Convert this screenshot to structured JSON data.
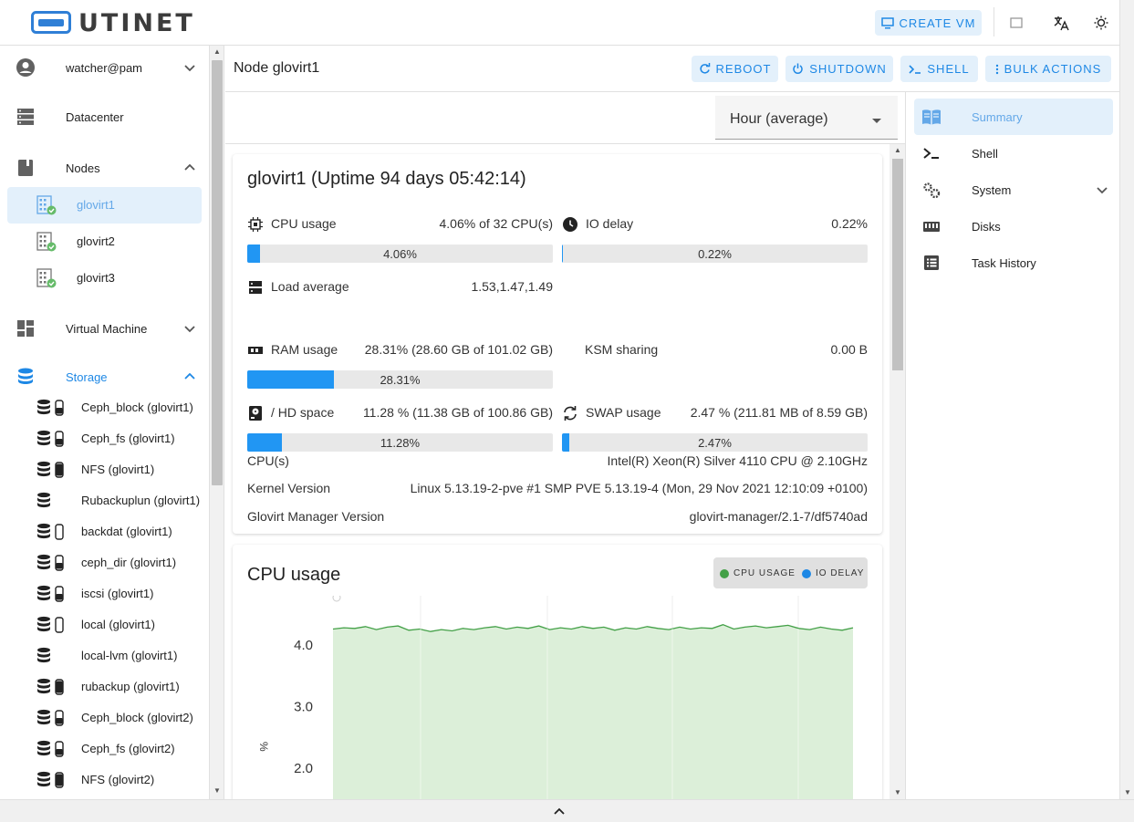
{
  "app": {
    "logo_text": "UTINET"
  },
  "topbar": {
    "create_vm_label": "CREATE VM",
    "icons": [
      "monitor-icon",
      "square-icon",
      "translate-icon",
      "brightness-icon"
    ]
  },
  "sidebar": {
    "user": "watcher@pam",
    "datacenter": "Datacenter",
    "nodes_label": "Nodes",
    "nodes": [
      "glovirt1",
      "glovirt2",
      "glovirt3"
    ],
    "active_node": "glovirt1",
    "vm_label": "Virtual Machine",
    "storage_label": "Storage",
    "storage": [
      "Ceph_block (glovirt1)",
      "Ceph_fs (glovirt1)",
      "NFS (glovirt1)",
      "Rubackuplun (glovirt1)",
      "backdat (glovirt1)",
      "ceph_dir (glovirt1)",
      "iscsi (glovirt1)",
      "local (glovirt1)",
      "local-lvm (glovirt1)",
      "rubackup (glovirt1)",
      "Ceph_block (glovirt2)",
      "Ceph_fs (glovirt2)",
      "NFS (glovirt2)"
    ]
  },
  "header": {
    "title": "Node glovirt1",
    "reboot": "REBOOT",
    "shutdown": "SHUTDOWN",
    "shell": "SHELL",
    "bulk": "BULK ACTIONS"
  },
  "timeframe": {
    "value": "Hour (average)"
  },
  "summary": {
    "title": "glovirt1 (Uptime 94 days 05:42:14)",
    "cpu": {
      "label": "CPU usage",
      "value": "4.06% of 32 CPU(s)",
      "bar_label": "4.06%",
      "fraction": 0.0406
    },
    "io": {
      "label": "IO delay",
      "value": "0.22%",
      "bar_label": "0.22%",
      "fraction": 0.0022
    },
    "load": {
      "label": "Load average",
      "value": "1.53,1.47,1.49"
    },
    "ram": {
      "label": "RAM usage",
      "value": "28.31% (28.60 GB of 101.02 GB)",
      "bar_label": "28.31%",
      "fraction": 0.2831
    },
    "ksm": {
      "label": "KSM sharing",
      "value": "0.00 B"
    },
    "hd": {
      "label": "/ HD space",
      "value": "11.28 % (11.38 GB of 100.86 GB)",
      "bar_label": "11.28%",
      "fraction": 0.1128
    },
    "swap": {
      "label": "SWAP usage",
      "value": "2.47 % (211.81 MB of 8.59 GB)",
      "bar_label": "2.47%",
      "fraction": 0.0247
    },
    "info": [
      {
        "k": "CPU(s)",
        "v": "Intel(R) Xeon(R) Silver 4110 CPU @ 2.10GHz"
      },
      {
        "k": "Kernel Version",
        "v": "Linux 5.13.19-2-pve #1 SMP PVE 5.13.19-4 (Mon, 29 Nov 2021 12:10:09 +0100)"
      },
      {
        "k": "Glovirt Manager Version",
        "v": "glovirt-manager/2.1-7/df5740ad"
      }
    ]
  },
  "cpu_chart": {
    "title": "CPU usage",
    "legend_cpu": "CPU USAGE",
    "legend_io": "IO DELAY",
    "ylabel": "%",
    "colors": {
      "cpu": "#43a047",
      "io": "#1e88e5",
      "fill": "#dcefd9"
    }
  },
  "chart_data": {
    "type": "area",
    "title": "CPU usage",
    "xlabel": "",
    "ylabel": "%",
    "y_ticks": [
      "4.0",
      "3.0",
      "2.0"
    ],
    "ylim": [
      1.5,
      4.4
    ],
    "series": [
      {
        "name": "CPU USAGE",
        "values": [
          4.26,
          4.28,
          4.27,
          4.3,
          4.25,
          4.29,
          4.31,
          4.24,
          4.26,
          4.22,
          4.25,
          4.23,
          4.27,
          4.25,
          4.28,
          4.3,
          4.26,
          4.29,
          4.27,
          4.31,
          4.25,
          4.28,
          4.26,
          4.3,
          4.27,
          4.29,
          4.24,
          4.28,
          4.26,
          4.3,
          4.27,
          4.25,
          4.29,
          4.26,
          4.28,
          4.27,
          4.33,
          4.26,
          4.29,
          4.31,
          4.28,
          4.3,
          4.32,
          4.27,
          4.25,
          4.29,
          4.26,
          4.24,
          4.28
        ]
      },
      {
        "name": "IO DELAY",
        "values": []
      }
    ]
  },
  "right_nav": {
    "items": [
      {
        "label": "Summary"
      },
      {
        "label": "Shell"
      },
      {
        "label": "System"
      },
      {
        "label": "Disks"
      },
      {
        "label": "Task History"
      }
    ]
  }
}
